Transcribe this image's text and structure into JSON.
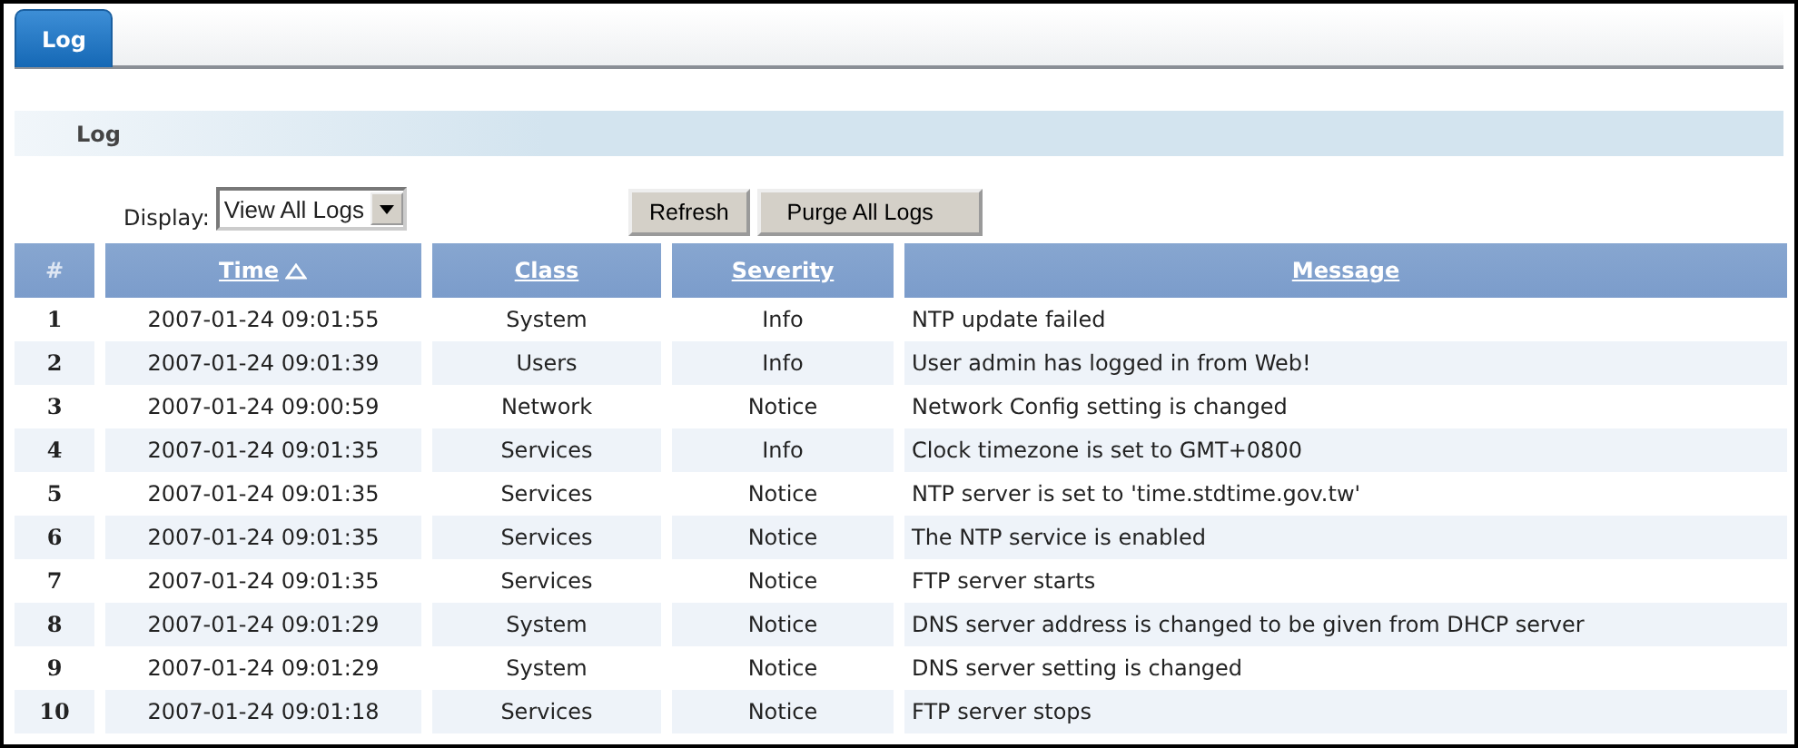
{
  "tabs": [
    {
      "label": "Log",
      "selected": true
    }
  ],
  "section": {
    "title": "Log"
  },
  "display": {
    "label": "Display:",
    "value": "View All Logs"
  },
  "buttons": [
    "Refresh",
    "Purge All Logs"
  ],
  "table": {
    "columns": [
      {
        "label": "#",
        "sorted": false
      },
      {
        "label": "Time",
        "sorted": true
      },
      {
        "label": "Class",
        "sorted": false
      },
      {
        "label": "Severity",
        "sorted": false
      },
      {
        "label": "Message",
        "sorted": false
      }
    ],
    "rows": [
      [
        "1",
        "2007-01-24 09:01:55",
        "System",
        "Info",
        "NTP update failed"
      ],
      [
        "2",
        "2007-01-24 09:01:39",
        "Users",
        "Info",
        "User admin has logged in from Web!"
      ],
      [
        "3",
        "2007-01-24 09:00:59",
        "Network",
        "Notice",
        "Network Config setting is changed"
      ],
      [
        "4",
        "2007-01-24 09:01:35",
        "Services",
        "Info",
        "Clock timezone is set to GMT+0800"
      ],
      [
        "5",
        "2007-01-24 09:01:35",
        "Services",
        "Notice",
        "NTP server is set to 'time.stdtime.gov.tw'"
      ],
      [
        "6",
        "2007-01-24 09:01:35",
        "Services",
        "Notice",
        "The NTP service is enabled"
      ],
      [
        "7",
        "2007-01-24 09:01:35",
        "Services",
        "Notice",
        "FTP server starts"
      ],
      [
        "8",
        "2007-01-24 09:01:29",
        "System",
        "Notice",
        "DNS server address is changed to be given from DHCP server"
      ],
      [
        "9",
        "2007-01-24 09:01:29",
        "System",
        "Notice",
        "DNS server setting is changed"
      ],
      [
        "10",
        "2007-01-24 09:01:18",
        "Services",
        "Notice",
        "FTP server stops"
      ]
    ]
  }
}
